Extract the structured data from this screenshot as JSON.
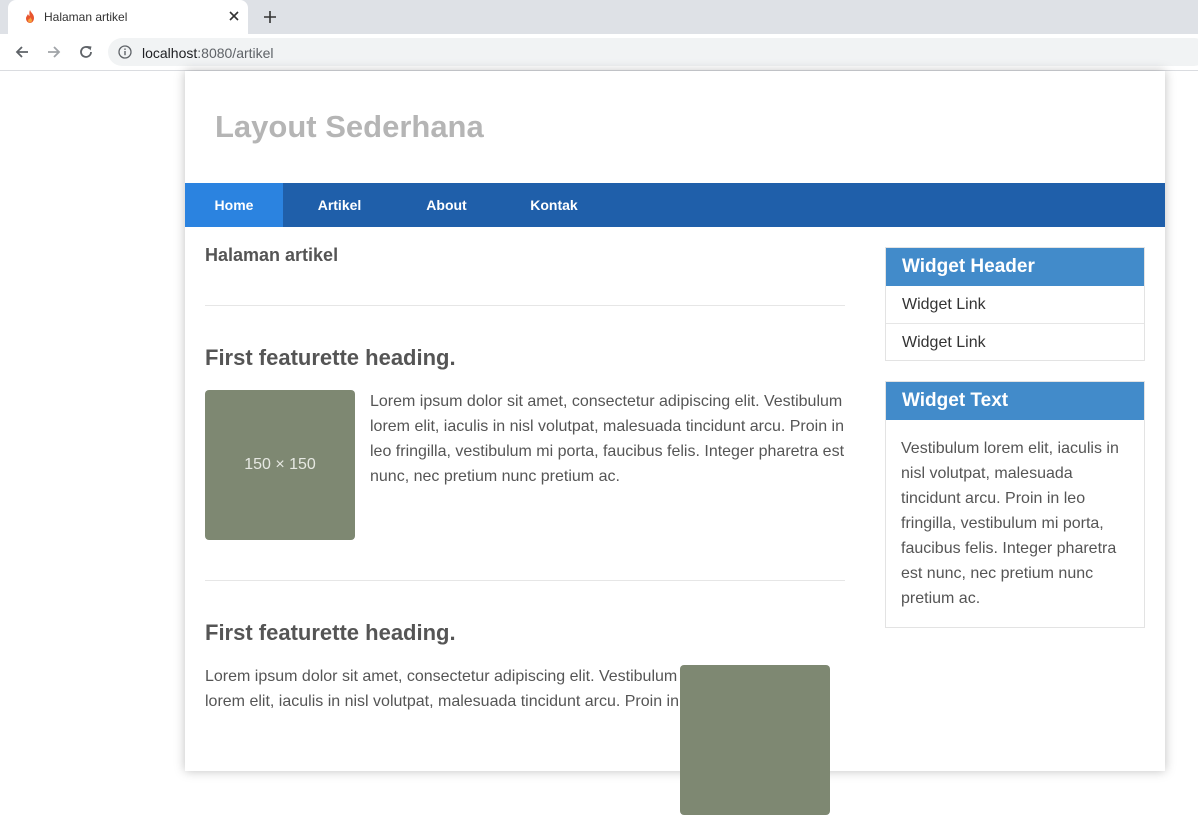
{
  "browser": {
    "tab_title": "Halaman artikel",
    "url_host": "localhost",
    "url_rest": ":8080/artikel"
  },
  "site": {
    "title": "Layout Sederhana"
  },
  "nav": {
    "items": [
      {
        "label": "Home",
        "active": true
      },
      {
        "label": "Artikel",
        "active": false
      },
      {
        "label": "About",
        "active": false
      },
      {
        "label": "Kontak",
        "active": false
      }
    ]
  },
  "main": {
    "page_heading": "Halaman artikel",
    "featurettes": [
      {
        "heading": "First featurette heading.",
        "thumb_label": "150 × 150",
        "text_lines": [
          "Lorem ipsum dolor sit amet, consectetur adipiscing elit. Vestibulum",
          "lorem elit, iaculis in nisl volutpat, malesuada tincidunt arcu. Proin in",
          "leo fringilla, vestibulum mi porta, faucibus felis. Integer pharetra est",
          "nunc, nec pretium nunc pretium ac."
        ]
      },
      {
        "heading": "First featurette heading.",
        "text_lines": [
          "Lorem ipsum dolor sit amet, consectetur adipiscing elit. Vestibulum",
          "lorem elit, iaculis in nisl volutpat, malesuada tincidunt arcu. Proin in"
        ]
      }
    ]
  },
  "sidebar": {
    "widget1": {
      "header": "Widget Header",
      "links": [
        "Widget Link",
        "Widget Link"
      ]
    },
    "widget2": {
      "header": "Widget Text",
      "text_lines": [
        "Vestibulum lorem elit, iaculis in",
        "nisl volutpat, malesuada",
        "tincidunt arcu. Proin in leo",
        "fringilla, vestibulum mi porta,",
        "faucibus felis. Integer pharetra",
        "est nunc, nec pretium nunc",
        "pretium ac."
      ]
    }
  },
  "colors": {
    "nav_bg": "#1f5faa",
    "nav_active": "#2b83e0",
    "widget_header": "#428bca",
    "thumb": "#7e8872",
    "site_title": "#b5b5b5"
  }
}
